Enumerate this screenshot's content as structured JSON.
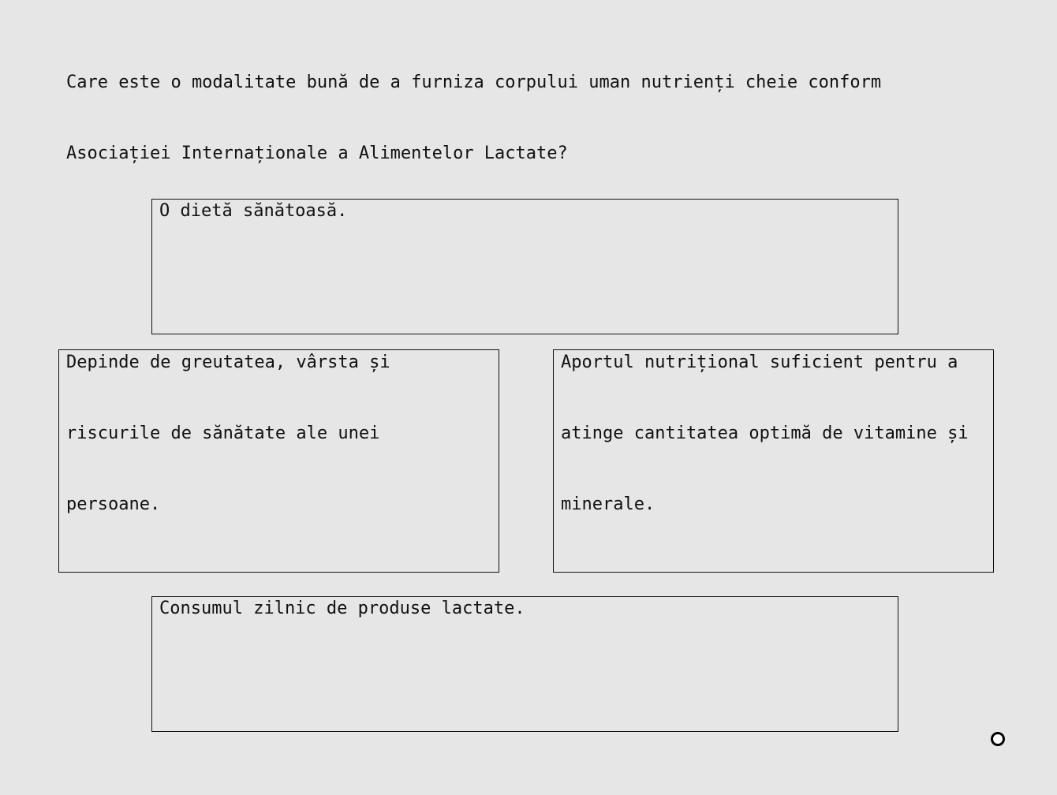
{
  "question": {
    "line1": "Care este o modalitate bună de a furniza corpului uman nutrienți cheie conform",
    "line2": "Asociației Internaționale a Alimentelor Lactate?"
  },
  "answers": [
    {
      "lines": [
        "O dietă sănătoasă."
      ]
    },
    {
      "lines": [
        "Depinde de greutatea, vârsta și",
        "riscurile de sănătate ale unei",
        "persoane."
      ]
    },
    {
      "lines": [
        "Aportul nutrițional suficient pentru a",
        "atinge cantitatea optimă de vitamine și",
        "minerale."
      ]
    },
    {
      "lines": [
        "Consumul zilnic de produse lactate."
      ]
    }
  ],
  "cursor": {
    "icon": "cursor-ring-icon"
  }
}
